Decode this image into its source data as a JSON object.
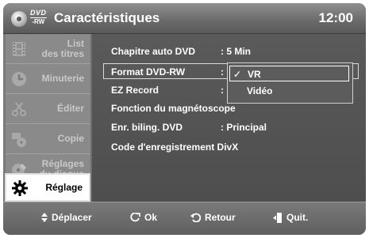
{
  "header": {
    "logo_top": "DVD",
    "logo_bottom": "-RW",
    "title": "Caractéristiques",
    "time": "12:00"
  },
  "sidebar": {
    "items": [
      {
        "label": "List\ndes titres"
      },
      {
        "label": "Minuterie"
      },
      {
        "label": "Éditer"
      },
      {
        "label": "Copie"
      },
      {
        "label": "Réglages\ndu disque"
      },
      {
        "label": "Réglage"
      }
    ]
  },
  "menu": {
    "rows": [
      {
        "label": "Chapitre auto DVD",
        "value": ": 5 Min"
      },
      {
        "label": "Format DVD-RW",
        "value": ":"
      },
      {
        "label": "EZ Record",
        "value": ":"
      },
      {
        "label": "Fonction du magnétoscope",
        "value": ""
      },
      {
        "label": "Enr. biling. DVD",
        "value": ": Principal"
      },
      {
        "label": "Code d'enregistrement DivX",
        "value": ""
      }
    ],
    "dropdown": {
      "options": [
        {
          "label": "VR",
          "check": "✓"
        },
        {
          "label": "Vidéo",
          "check": ""
        }
      ]
    }
  },
  "footer": {
    "move": "Déplacer",
    "ok": "Ok",
    "back": "Retour",
    "quit": "Quit."
  },
  "colors": {
    "accent": "#ffffff",
    "background": "#5a5a5a"
  }
}
